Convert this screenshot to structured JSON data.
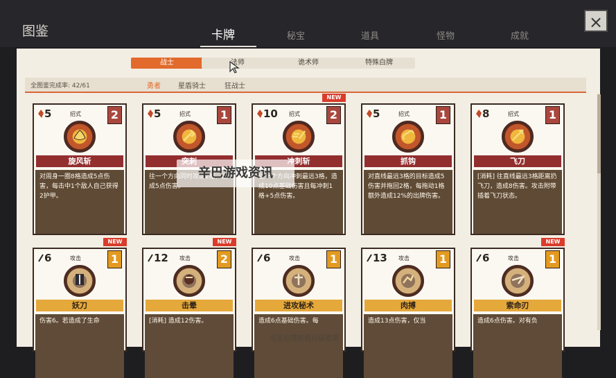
{
  "title": "图鉴",
  "tabs": {
    "cards": "卡牌",
    "secrets": "秘宝",
    "items": "道具",
    "monsters": "怪物",
    "achievements": "成就"
  },
  "classes": {
    "warrior": "战士",
    "mage": "法师",
    "trickster": "诡术师",
    "special": "特殊白牌"
  },
  "progress": "全图鉴完成率: 42/61",
  "subclasses": {
    "brave": "勇者",
    "star_shield": "星盾骑士",
    "berserker": "狂战士"
  },
  "cards": [
    {
      "name": "旋风斩",
      "cost": "5",
      "type": "招式",
      "level": "2",
      "desc": "对周身一圈8格造成5点伤害，每击中1个敌人自己获得2护甲。",
      "new": false
    },
    {
      "name": "突刺",
      "cost": "5",
      "type": "招式",
      "level": "1",
      "desc": "往一个方向同时攻击2格，造成5点伤害。",
      "new": false
    },
    {
      "name": "冲刺斩",
      "cost": "10",
      "type": "招式",
      "level": "2",
      "desc": "往一个方向冲刺最远3格，造成10点基础伤害且每冲刺1格+5点伤害。",
      "new": true
    },
    {
      "name": "抓钩",
      "cost": "5",
      "type": "招式",
      "level": "1",
      "desc": "对直线最远3格的目标造成5伤害并拖回2格，每拖动1格额外造成12%的出牌伤害。",
      "new": false
    },
    {
      "name": "飞刀",
      "cost": "8",
      "type": "招式",
      "level": "1",
      "desc": "[消耗] 往直线最远3格距离扔飞刀，造成8伤害。攻击附带插着飞刀状态。",
      "new": false
    },
    {
      "name": "妖刀",
      "cost": "6",
      "type": "攻击",
      "level": "1",
      "desc": "伤害6。若造成了生命",
      "new": true
    },
    {
      "name": "击晕",
      "cost": "12",
      "type": "攻击",
      "level": "2",
      "desc": "[消耗] 造成12伤害。",
      "new": true
    },
    {
      "name": "进攻秘术",
      "cost": "6",
      "type": "攻击",
      "level": "1",
      "desc": "造成6点基础伤害。每",
      "new": false
    },
    {
      "name": "肉搏",
      "cost": "13",
      "type": "攻击",
      "level": "1",
      "desc": "造成13点伤害，仅当",
      "new": false
    },
    {
      "name": "索命刃",
      "cost": "6",
      "type": "攻击",
      "level": "1",
      "desc": "造成6点伤害。对有负",
      "new": true
    }
  ],
  "badges": {
    "new": "NEW"
  },
  "hint": "点击右键查看升级效果",
  "watermark": "辛巴游戏资讯"
}
